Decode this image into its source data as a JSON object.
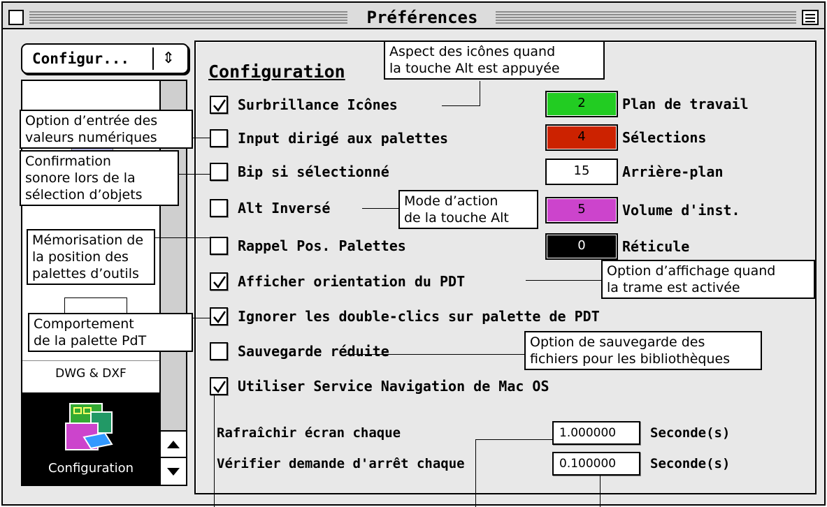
{
  "window": {
    "title": "Préférences"
  },
  "sidebar": {
    "popup_label": "Configur...",
    "popup_arrows": "⇕",
    "items": [
      {
        "label": "DWG & DXF"
      },
      {
        "label": "Configuration"
      }
    ]
  },
  "panel": {
    "title": "Configuration",
    "options": [
      {
        "label": "Surbrillance Icônes",
        "checked": true
      },
      {
        "label": "Input dirigé aux palettes",
        "checked": false
      },
      {
        "label": "Bip si sélectionné",
        "checked": false
      },
      {
        "label": "Alt Inversé",
        "checked": false
      },
      {
        "label": "Rappel Pos. Palettes",
        "checked": false
      },
      {
        "label": "Afficher orientation du PDT",
        "checked": true
      },
      {
        "label": "Ignorer les double-clics sur palette de PDT",
        "checked": true
      },
      {
        "label": "Sauvegarde réduite",
        "checked": false
      },
      {
        "label": "Utiliser Service Navigation de Mac OS",
        "checked": true
      }
    ],
    "colors": [
      {
        "value": "2",
        "label": "Plan de travail",
        "color": "#22cc22",
        "text_color": "#000000"
      },
      {
        "value": "4",
        "label": "Sélections",
        "color": "#cc2200",
        "text_color": "#000000"
      },
      {
        "value": "15",
        "label": "Arrière-plan",
        "color": "#ffffff",
        "text_color": "#000000"
      },
      {
        "value": "5",
        "label": "Volume d'inst.",
        "color": "#cc44cc",
        "text_color": "#000000"
      },
      {
        "value": "0",
        "label": "Réticule",
        "color": "#000000",
        "text_color": "#ffffff"
      }
    ],
    "refresh": {
      "label": "Rafraîchir écran chaque",
      "value": "1.000000",
      "unit": "Seconde(s)"
    },
    "stop_check": {
      "label": "Vérifier demande d'arrêt chaque",
      "value": "0.100000",
      "unit": "Seconde(s)"
    }
  },
  "callouts": {
    "alt_icons": [
      "Aspect des icônes quand",
      "la touche Alt est appuyée"
    ],
    "numeric_input": [
      "Option d’entrée des",
      "valeurs numériques"
    ],
    "beep": [
      "Confirmation",
      "sonore lors de la",
      "sélection d’objets"
    ],
    "alt_mode": [
      "Mode d’action",
      "de la touche Alt"
    ],
    "palette_pos": [
      "Mémorisation de",
      "la position des",
      "palettes d’outils"
    ],
    "grid_display": [
      "Option d’affichage quand",
      "la trame est activée"
    ],
    "pdt_palette": [
      "Comportement",
      "de la palette PdT"
    ],
    "save_option": [
      "Option de sauvegarde des",
      "fichiers pour les bibliothèques"
    ]
  }
}
